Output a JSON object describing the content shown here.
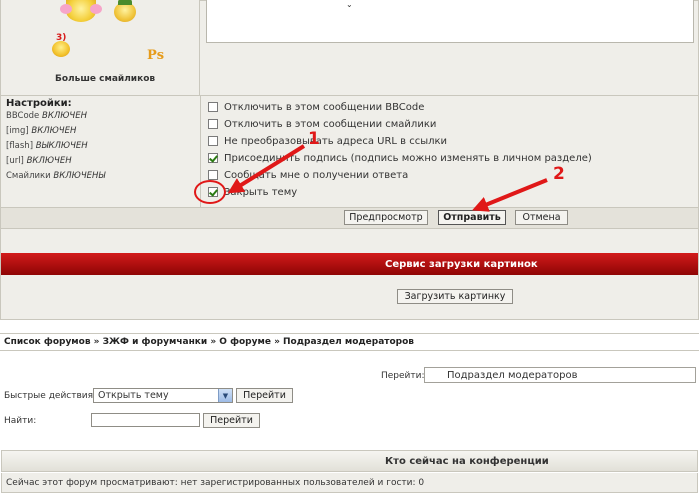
{
  "smileys": {
    "items": [
      "smiley-girl-icon",
      "smiley-hat-icon",
      "smiley-3-icon",
      "smiley-ps-icon"
    ],
    "ps_text": "Ps",
    "badge_text": "3)",
    "more_label": "Больше смайликов"
  },
  "settings": {
    "title": "Настройки:",
    "lines": [
      {
        "name": "BBCode",
        "state": "ВКЛЮЧЕН"
      },
      {
        "name": "[img]",
        "state": "ВКЛЮЧЕН"
      },
      {
        "name": "[flash]",
        "state": "ВЫКЛЮЧЕН"
      },
      {
        "name": "[url]",
        "state": "ВКЛЮЧЕН"
      },
      {
        "name": "Смайлики",
        "state": "ВКЛЮЧЕНЫ"
      }
    ]
  },
  "options": [
    {
      "label": "Отключить в этом сообщении BBCode",
      "checked": false
    },
    {
      "label": "Отключить в этом сообщении смайлики",
      "checked": false
    },
    {
      "label": "Не преобразовывать адреса URL в ссылки",
      "checked": false
    },
    {
      "label": "Присоединить подпись (подпись можно изменять в личном разделе)",
      "checked": true
    },
    {
      "label": "Сообщать мне о получении ответа",
      "checked": false
    },
    {
      "label": "Закрыть тему",
      "checked": true
    }
  ],
  "buttons": {
    "preview": "Предпросмотр",
    "submit": "Отправить",
    "cancel": "Отмена"
  },
  "upload": {
    "title": "Сервис загрузки картинок",
    "button": "Загрузить картинку"
  },
  "breadcrumb": "Список форумов » ЗЖФ и форумчанки » О форуме » Подраздел модераторов",
  "jump": {
    "label": "Перейти:",
    "value": "Подраздел модераторов"
  },
  "quick_actions": {
    "label": "Быстрые действия:",
    "value": "Открыть тему",
    "go": "Перейти"
  },
  "find": {
    "label": "Найти:",
    "value": "",
    "go": "Перейти"
  },
  "online": {
    "title": "Кто сейчас на конференции",
    "text": "Сейчас этот форум просматривают: нет зарегистрированных пользователей и гости: 0"
  },
  "annotations": {
    "one": "1",
    "two": "2"
  },
  "colors": {
    "annotation_red": "#e01818",
    "header_red": "#b80f0f"
  }
}
